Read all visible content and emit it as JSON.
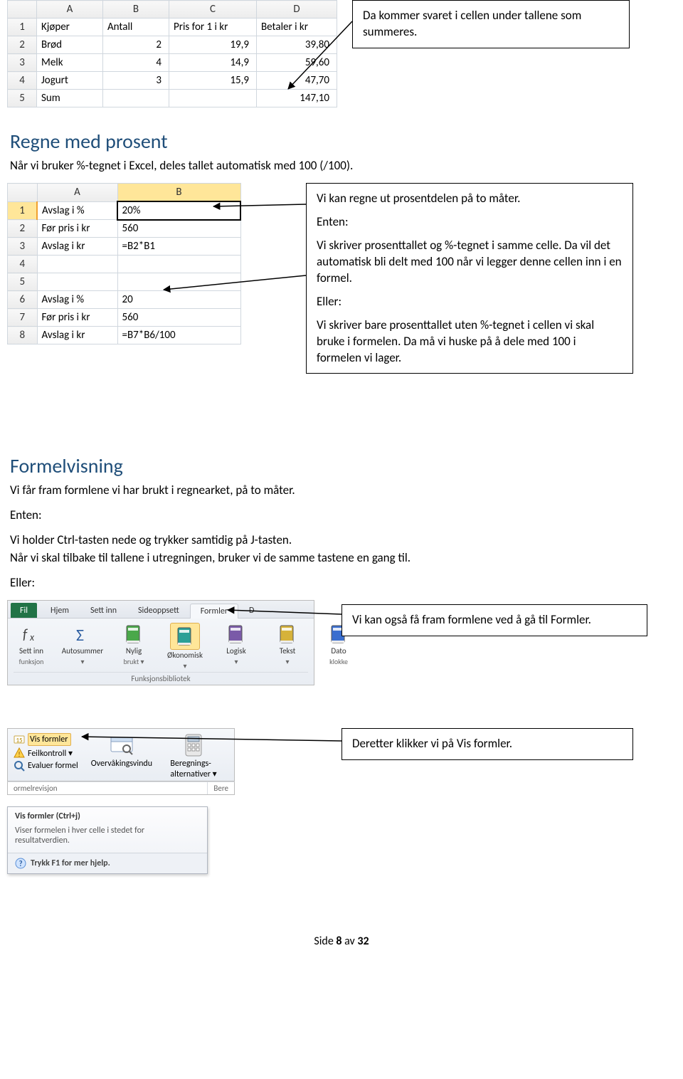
{
  "callout1": "Da kommer svaret i cellen under tallene som summeres.",
  "table1": {
    "headers": [
      "A",
      "B",
      "C",
      "D"
    ],
    "rows": [
      {
        "n": "1",
        "A": "Kjøper",
        "B": "Antall",
        "C": "Pris for 1 i kr",
        "D": "Betaler i kr"
      },
      {
        "n": "2",
        "A": "Brød",
        "B": "2",
        "C": "19,9",
        "D": "39,80"
      },
      {
        "n": "3",
        "A": "Melk",
        "B": "4",
        "C": "14,9",
        "D": "59,60"
      },
      {
        "n": "4",
        "A": "Jogurt",
        "B": "3",
        "C": "15,9",
        "D": "47,70"
      },
      {
        "n": "5",
        "A": "Sum",
        "B": "",
        "C": "",
        "D": "147,10"
      }
    ]
  },
  "heading1": "Regne med prosent",
  "para1": "Når vi bruker %-tegnet i Excel, deles tallet automatisk med 100 (/100).",
  "table2": {
    "headers": [
      "A",
      "B"
    ],
    "rows": [
      {
        "n": "1",
        "A": "Avslag i %",
        "B": "20%"
      },
      {
        "n": "2",
        "A": "Før pris i kr",
        "B": "560"
      },
      {
        "n": "3",
        "A": "Avslag i kr",
        "B": "=B2*B1"
      },
      {
        "n": "4",
        "A": "",
        "B": ""
      },
      {
        "n": "5",
        "A": "",
        "B": ""
      },
      {
        "n": "6",
        "A": "Avslag i %",
        "B": "20"
      },
      {
        "n": "7",
        "A": "Før pris i kr",
        "B": "560"
      },
      {
        "n": "8",
        "A": "Avslag i kr",
        "B": "=B7*B6/100"
      }
    ]
  },
  "callout2": {
    "l1": "Vi kan regne ut prosentdelen på to måter.",
    "l2": "Enten:",
    "l3": "Vi skriver prosenttallet og %-tegnet i samme celle. Da vil det automatisk bli delt med 100 når vi legger denne cellen inn i en formel.",
    "l4": "Eller:",
    "l5": "Vi skriver bare prosenttallet uten %-tegnet i cellen vi skal bruke i formelen. Da må vi huske på å dele med 100 i formelen vi lager."
  },
  "heading2": "Formelvisning",
  "para2": "Vi får fram formlene vi har brukt i regnearket, på to måter.",
  "para3": "Enten:",
  "para4": "Vi holder Ctrl-tasten nede og trykker samtidig på J-tasten.",
  "para5": "Når vi skal tilbake til tallene i utregningen, bruker vi de samme tastene en gang til.",
  "para6": "Eller:",
  "ribbon": {
    "tabs": {
      "file": "Fil",
      "hjem": "Hjem",
      "settinn": "Sett inn",
      "sideoppsett": "Sideoppsett",
      "formler": "Formler",
      "d": "D"
    },
    "groups": [
      {
        "icon": "fx",
        "label": "Sett inn",
        "sub": "funksjon"
      },
      {
        "icon": "sigma",
        "label": "Autosummer",
        "sub": "▾"
      },
      {
        "icon": "book-green",
        "label": "Nylig",
        "sub": "brukt ▾"
      },
      {
        "icon": "book-teal",
        "label": "Økonomisk",
        "sub": "▾"
      },
      {
        "icon": "book-purple",
        "label": "Logisk",
        "sub": "▾"
      },
      {
        "icon": "book-yellow",
        "label": "Tekst",
        "sub": "▾"
      },
      {
        "icon": "book-blue",
        "label": "Dato",
        "sub": "klokke"
      }
    ],
    "section": "Funksjonsbibliotek"
  },
  "callout3": "Vi kan også få fram formlene ved å gå til Formler.",
  "audit": {
    "vis": "Vis formler",
    "feil": "Feilkontroll ▾",
    "eval": "Evaluer formel",
    "win": "Overvåkingsvindu",
    "calc": "Beregnings-",
    "calc2": "alternativer ▾",
    "footL": "ormelrevisjon",
    "footR": "Bere"
  },
  "callout4": "Deretter klikker vi på Vis formler.",
  "tooltip": {
    "title": "Vis formler (Ctrl+j)",
    "body": "Viser formelen i hver celle i stedet for resultatverdien.",
    "help": "Trykk F1 for mer hjelp."
  },
  "footer": {
    "pre": "Side ",
    "page": "8",
    "mid": " av ",
    "total": "32"
  }
}
